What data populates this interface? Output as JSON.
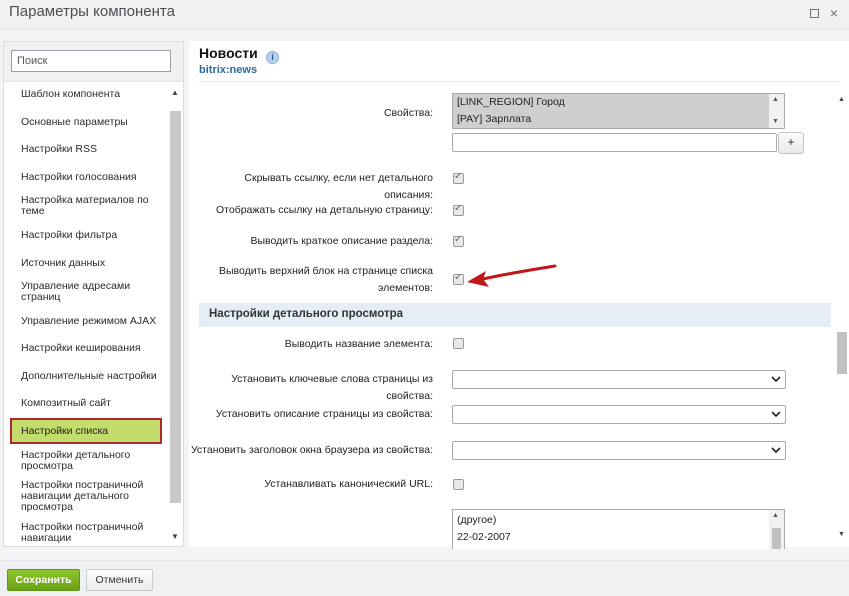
{
  "window": {
    "title": "Параметры компонента",
    "minimize_icon": "minimize-icon",
    "close_label": "×"
  },
  "sidebar": {
    "search_placeholder": "Поиск",
    "items": [
      {
        "label": "Шаблон компонента"
      },
      {
        "label": "Основные параметры"
      },
      {
        "label": "Настройки RSS"
      },
      {
        "label": "Настройки голосования"
      },
      {
        "label": "Настройка материалов по теме"
      },
      {
        "label": "Настройки фильтра"
      },
      {
        "label": "Источник данных"
      },
      {
        "label": "Управление адресами страниц"
      },
      {
        "label": "Управление режимом AJAX"
      },
      {
        "label": "Настройки кеширования"
      },
      {
        "label": "Дополнительные настройки"
      },
      {
        "label": "Композитный сайт"
      },
      {
        "label": "Настройки списка",
        "active": true
      },
      {
        "label": "Настройки детального просмотра"
      },
      {
        "label": "Настройки постраничной навигации детального просмотра"
      },
      {
        "label": "Настройки постраничной навигации"
      }
    ]
  },
  "component": {
    "title": "Новости",
    "code": "bitrix:news",
    "info_icon": "info-icon"
  },
  "properties": {
    "label": "Свойства:",
    "options": [
      "[LINK_REGION] Город",
      "[PAY] Зарплата"
    ],
    "add_label": "+"
  },
  "list_settings": [
    {
      "label": "Скрывать ссылку, если нет детального описания:",
      "checked": true
    },
    {
      "label": "Отображать ссылку на детальную страницу:",
      "checked": true
    },
    {
      "label": "Выводить краткое описание раздела:",
      "checked": true
    },
    {
      "label": "Выводить верхний блок на странице списка элементов:",
      "checked": true
    }
  ],
  "detail_section": {
    "title": "Настройки детального просмотра",
    "show_name": {
      "label": "Выводить название элемента:",
      "checked": false
    },
    "keywords": {
      "label": "Установить ключевые слова страницы из свойства:",
      "value": ""
    },
    "description": {
      "label": "Установить описание страницы из свойства:",
      "value": ""
    },
    "browser_title": {
      "label": "Установить заголовок окна браузера из свойства:",
      "value": ""
    },
    "canonical": {
      "label": "Устанавливать канонический URL:",
      "checked": false
    },
    "date_options": [
      "(другое)",
      "22-02-2007"
    ]
  },
  "footer": {
    "save_label": "Сохранить",
    "cancel_label": "Отменить"
  },
  "colors": {
    "active_item_bg": "#c2dd6b",
    "active_item_border": "#b0282c",
    "save_button": "#7ab31f",
    "annotation_arrow": "#c0171b",
    "component_code": "#2d6a9a"
  }
}
